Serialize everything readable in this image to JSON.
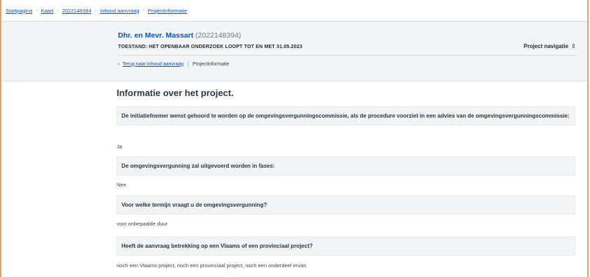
{
  "breadcrumb": [
    "Startpagina",
    "Kaart",
    "2022148394",
    "Inhoud aanvraag",
    "Projectinformatie"
  ],
  "header": {
    "name": "Dhr. en Mevr. Massart",
    "number": "(2022148394)",
    "status": "TOESTAND: HET OPENBAAR ONDERZOEK LOOPT TOT EN MET 31.05.2023",
    "nav_label": "Project navigatie",
    "nav_icon": "chevron-updown-icon",
    "back_link": "Terug naar inhoud aanvraag",
    "current": "Projectinformatie"
  },
  "main": {
    "title": "Informatie over het project.",
    "items": [
      {
        "question": "De initiatiefnemer wenst gehoord te worden op de omgevingsvergunningscommissie, als de procedure voorziet in een advies van de omgevingsvergunningscommissie:",
        "answer": "Ja"
      },
      {
        "question": "De omgevingsvergunning zal uitgevoerd worden in fases:",
        "answer": "Nee"
      },
      {
        "question": "Voor welke termijn vraagt u de omgevingsvergunning?",
        "answer": "voor onbepaalde duur"
      },
      {
        "question": "Heeft de aanvraag betrekking op een Vlaams of een provinciaal project?",
        "answer": "noch een Vlaams project, noch een provinciaal project, noch een onderdeel ervan."
      }
    ]
  },
  "colors": {
    "link": "#0055cc",
    "frame": "#e8a060",
    "panel": "#f2f4f6"
  }
}
